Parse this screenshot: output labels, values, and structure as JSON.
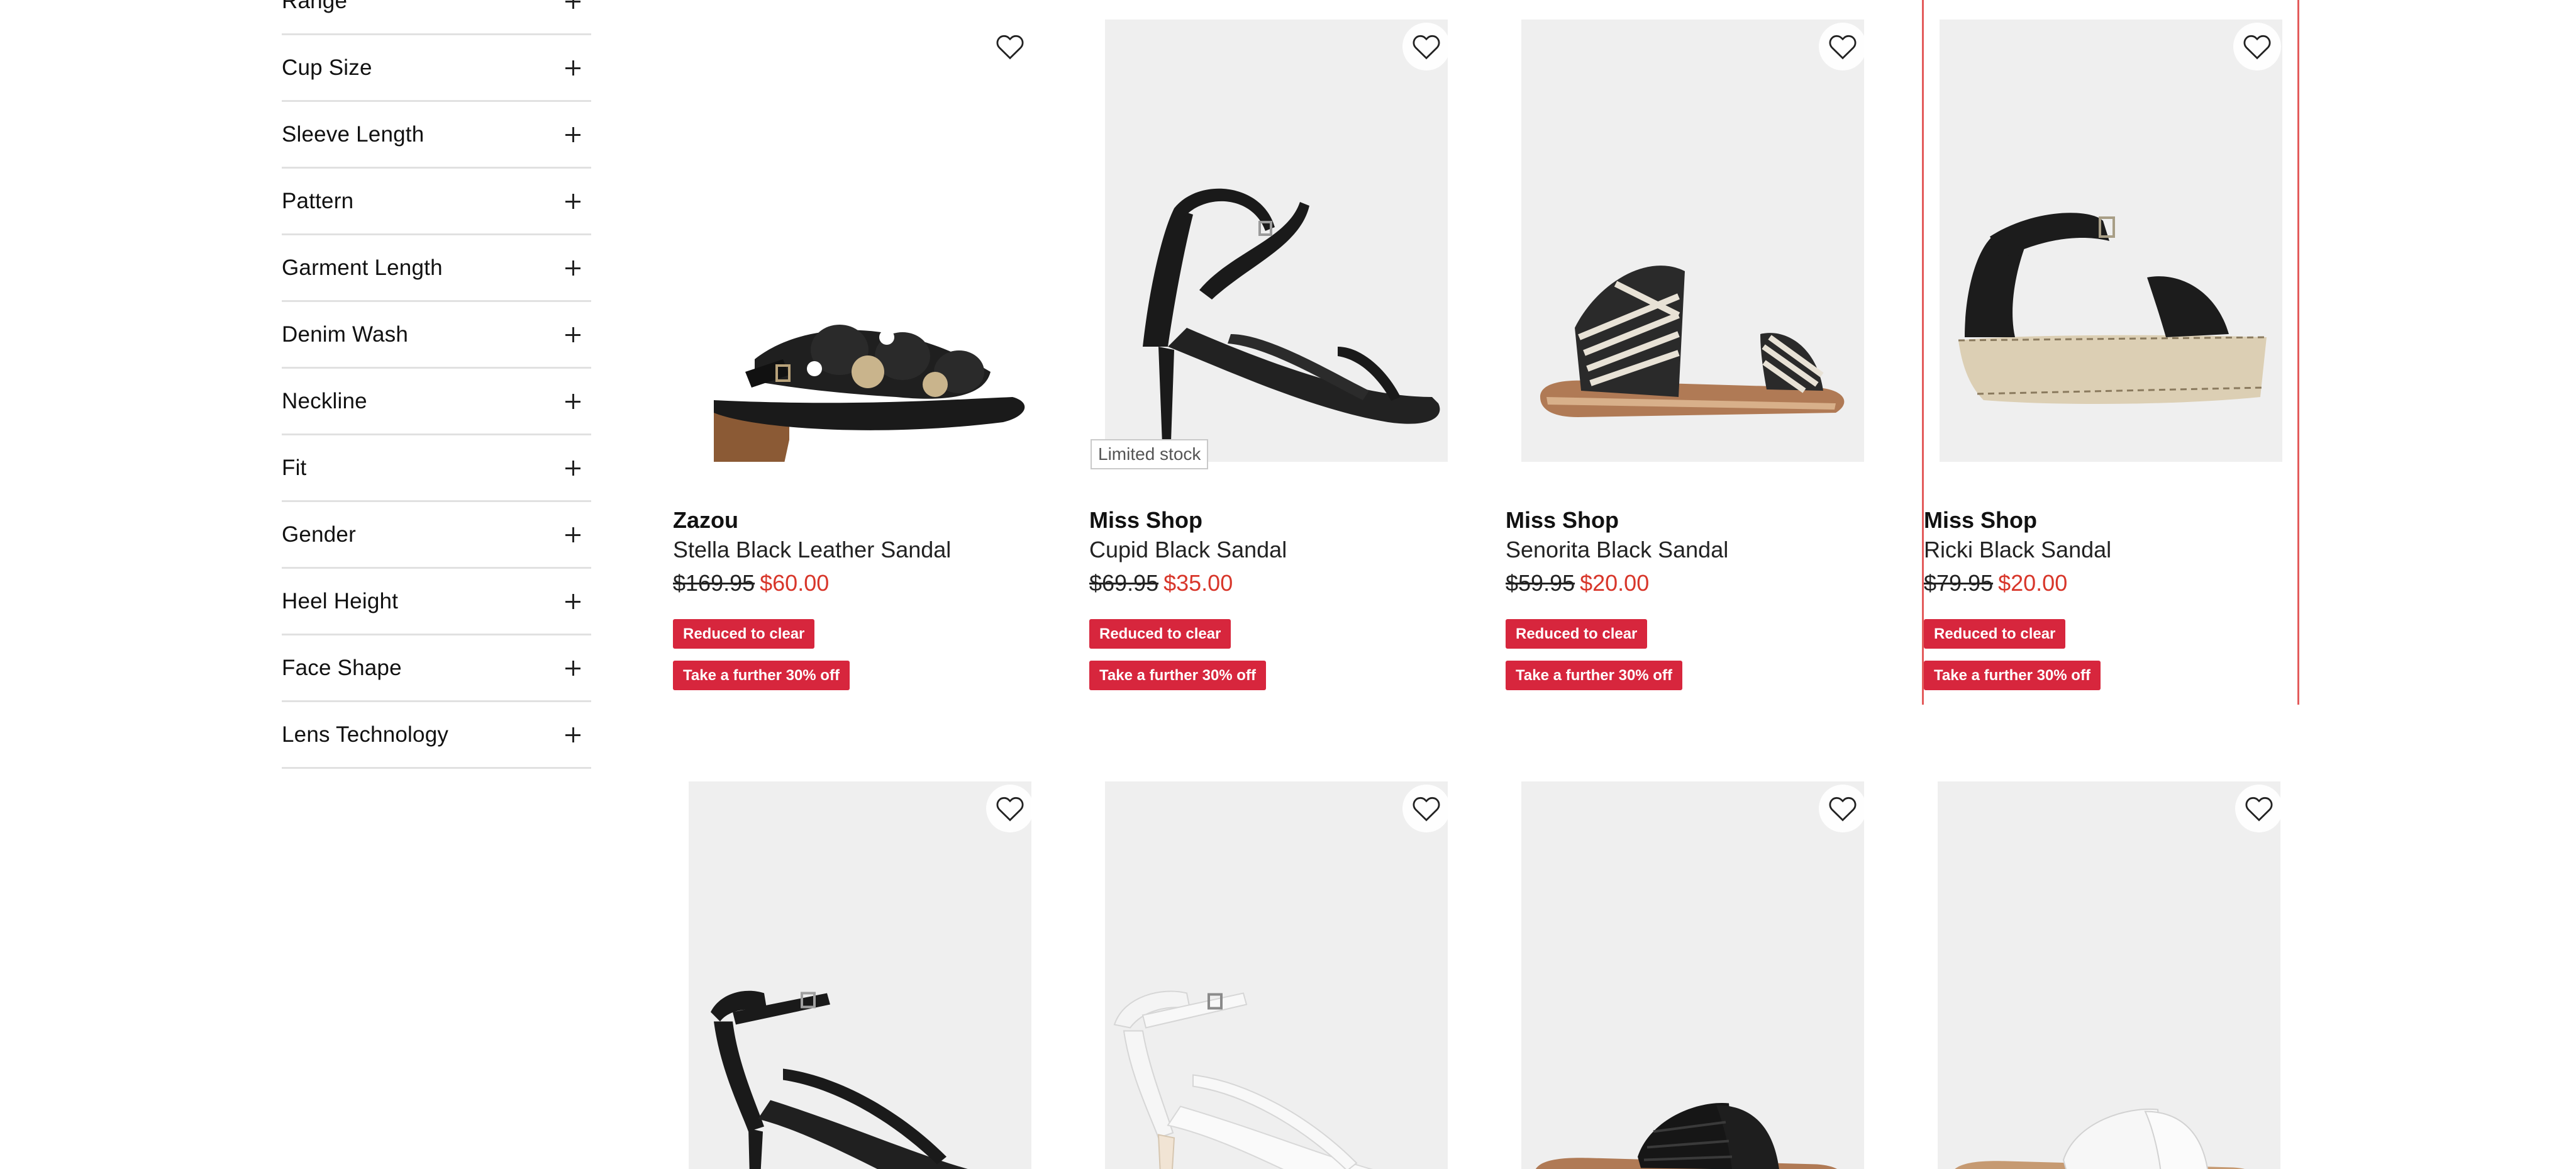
{
  "filters": [
    {
      "label": "Range"
    },
    {
      "label": "Cup Size"
    },
    {
      "label": "Sleeve Length"
    },
    {
      "label": "Pattern"
    },
    {
      "label": "Garment Length"
    },
    {
      "label": "Denim Wash"
    },
    {
      "label": "Neckline"
    },
    {
      "label": "Fit"
    },
    {
      "label": "Gender"
    },
    {
      "label": "Heel Height"
    },
    {
      "label": "Face Shape"
    },
    {
      "label": "Lens Technology"
    }
  ],
  "products": [
    {
      "brand": "Zazou",
      "name": "Stella Black Leather Sandal",
      "was": "$169.95",
      "now": "$60.00",
      "badge1": "Reduced to clear",
      "badge2": "Take a further 30% off"
    },
    {
      "brand": "Miss Shop",
      "name": "Cupid Black Sandal",
      "was": "$69.95",
      "now": "$35.00",
      "stock": "Limited stock",
      "badge1": "Reduced to clear",
      "badge2": "Take a further 30% off"
    },
    {
      "brand": "Miss Shop",
      "name": "Senorita Black Sandal",
      "was": "$59.95",
      "now": "$20.00",
      "badge1": "Reduced to clear",
      "badge2": "Take a further 30% off"
    },
    {
      "brand": "Miss Shop",
      "name": "Ricki Black Sandal",
      "was": "$79.95",
      "now": "$20.00",
      "badge1": "Reduced to clear",
      "badge2": "Take a further 30% off"
    },
    {},
    {},
    {},
    {}
  ],
  "colors": {
    "sale_red": "#d8362a",
    "badge_red": "#d7263d",
    "hover_frame": "#e35b5b",
    "divider": "#e1e1e1"
  },
  "icons": {
    "filter_expand": "plus-icon",
    "wishlist": "heart-outline-icon"
  }
}
